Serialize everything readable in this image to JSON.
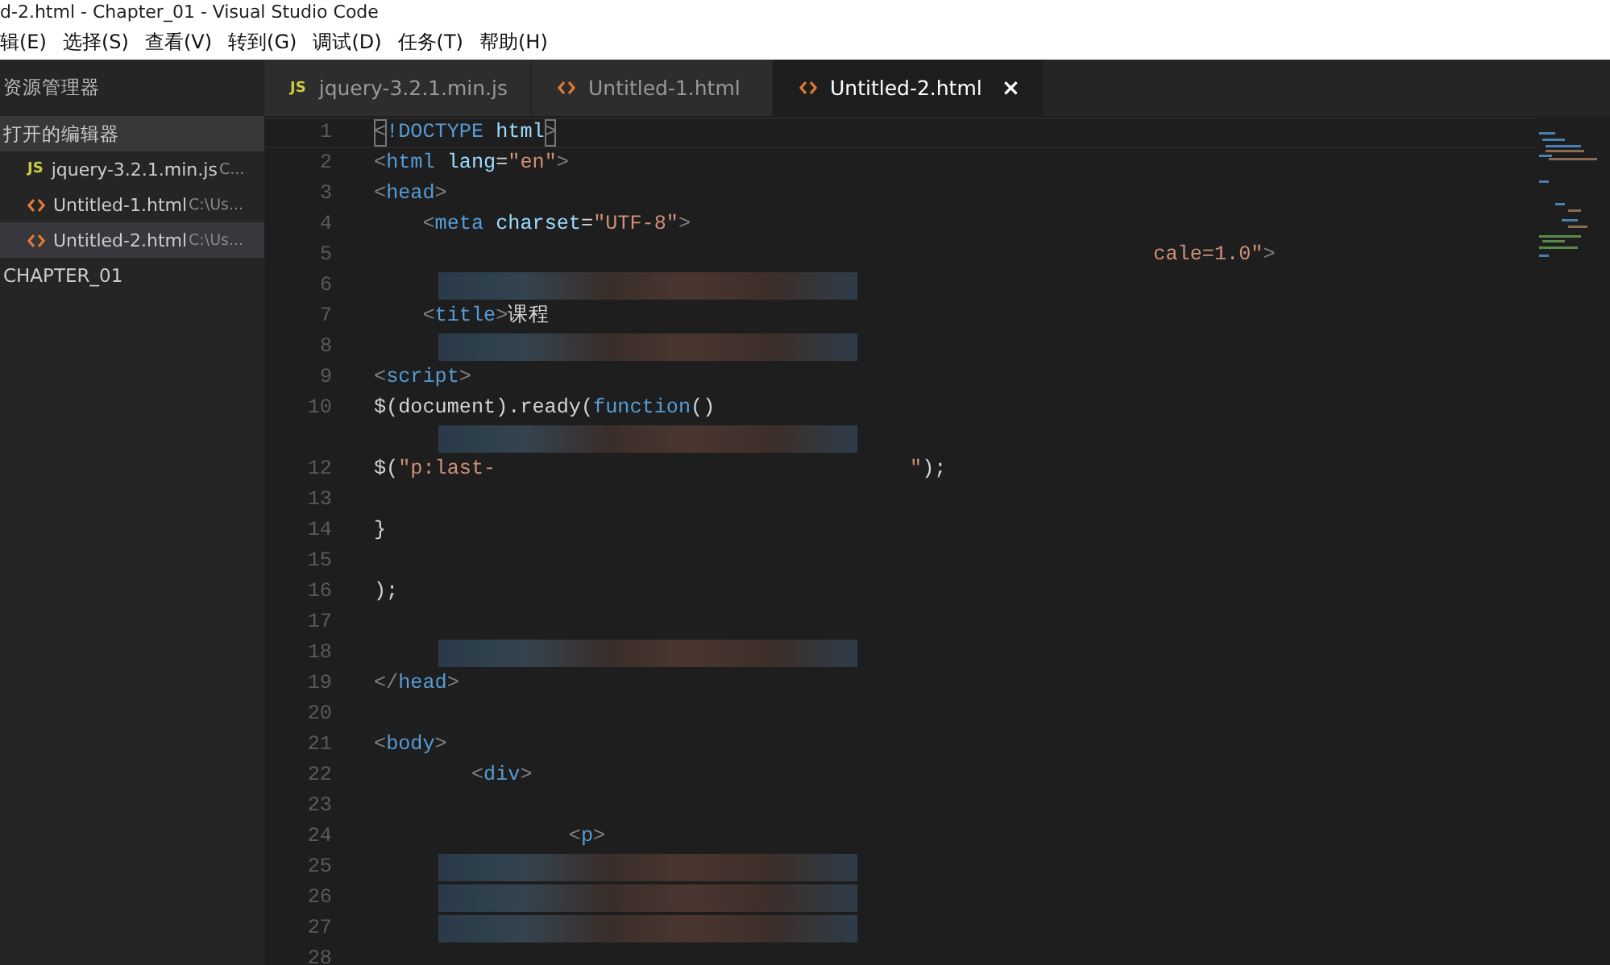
{
  "window": {
    "title": "d-2.html - Chapter_01 - Visual Studio Code"
  },
  "menu": [
    "辑(E)",
    "选择(S)",
    "查看(V)",
    "转到(G)",
    "调试(D)",
    "任务(T)",
    "帮助(H)"
  ],
  "sidebar": {
    "title": "资源管理器",
    "sections": [
      {
        "title": "打开的编辑器",
        "expanded": true,
        "items": [
          {
            "name": "jquery-3.2.1.min.js",
            "path": "C...",
            "kind": "js",
            "icon": "JS",
            "selected": false
          },
          {
            "name": "Untitled-1.html",
            "path": "C:\\Us...",
            "kind": "html",
            "selected": false
          },
          {
            "name": "Untitled-2.html",
            "path": "C:\\Us...",
            "kind": "html",
            "selected": true
          }
        ]
      },
      {
        "title": "CHAPTER_01",
        "expanded": false
      }
    ]
  },
  "tabs": [
    {
      "label": "jquery-3.2.1.min.js",
      "kind": "js",
      "icon": "JS",
      "selected": false
    },
    {
      "label": "Untitled-1.html",
      "kind": "html",
      "selected": false
    },
    {
      "label": "Untitled-2.html",
      "kind": "html",
      "selected": true,
      "close": "×"
    }
  ],
  "editor": {
    "lines": [
      {
        "number": "1",
        "tokens": [
          {
            "kind": "bracket",
            "text": "<"
          },
          {
            "kind": "tag",
            "text": "!DOCTYPE"
          },
          {
            "kind": "attr",
            "text": " html"
          },
          {
            "kind": "bracket",
            "text": ">"
          }
        ]
      },
      {
        "number": "2",
        "tokens": [
          {
            "kind": "punct",
            "text": "<"
          },
          {
            "kind": "tag",
            "text": "html"
          },
          {
            "kind": "attr",
            "text": " lang"
          },
          {
            "kind": "text",
            "text": "="
          },
          {
            "kind": "string",
            "text": "\"en\""
          },
          {
            "kind": "punct",
            "text": ">"
          }
        ]
      },
      {
        "number": "3",
        "tokens": [
          {
            "kind": "punct",
            "text": "<"
          },
          {
            "kind": "tag",
            "text": "head"
          },
          {
            "kind": "punct",
            "text": ">"
          }
        ]
      },
      {
        "number": "4",
        "tokens": [
          {
            "kind": "punct",
            "text": "    <"
          },
          {
            "kind": "tag",
            "text": "meta"
          },
          {
            "kind": "attr",
            "text": " charset"
          },
          {
            "kind": "text",
            "text": "="
          },
          {
            "kind": "string",
            "text": "\"UTF-8\""
          },
          {
            "kind": "punct",
            "text": ">"
          }
        ]
      },
      {
        "number": "5",
        "tokens": [
          {
            "kind": "string",
            "text": "                                                                cale=1.0\""
          },
          {
            "kind": "punct",
            "text": ">"
          }
        ]
      },
      {
        "number": "6",
        "obscured": true
      },
      {
        "number": "7",
        "tokens": [
          {
            "kind": "punct",
            "text": "    <"
          },
          {
            "kind": "tag",
            "text": "title"
          },
          {
            "kind": "punct",
            "text": ">"
          },
          {
            "kind": "text",
            "text": "课程"
          }
        ]
      },
      {
        "number": "8",
        "obscured": true
      },
      {
        "number": "9",
        "tokens": [
          {
            "kind": "punct",
            "text": "<"
          },
          {
            "kind": "tag",
            "text": "script"
          },
          {
            "kind": "punct",
            "text": ">"
          }
        ]
      },
      {
        "number": "10",
        "tokens": [
          {
            "kind": "text",
            "text": "$(document).ready("
          },
          {
            "kind": "tag",
            "text": "function"
          },
          {
            "kind": "text",
            "text": "()"
          }
        ]
      },
      {
        "obscured": true
      },
      {
        "number": "12",
        "tokens": [
          {
            "kind": "text",
            "text": "$("
          },
          {
            "kind": "string",
            "text": "\"p:last-"
          },
          {
            "kind": "string",
            "text": "                                  \""
          },
          {
            "kind": "text",
            "text": ");"
          }
        ]
      },
      {
        "number": "13"
      },
      {
        "number": "14",
        "tokens": [
          {
            "kind": "text",
            "text": "}"
          }
        ]
      },
      {
        "number": "15"
      },
      {
        "number": "16",
        "tokens": [
          {
            "kind": "text",
            "text": ");"
          }
        ]
      },
      {
        "number": "17"
      },
      {
        "number": "18",
        "obscured": true
      },
      {
        "number": "19",
        "tokens": [
          {
            "kind": "punct",
            "text": "</"
          },
          {
            "kind": "tag",
            "text": "head"
          },
          {
            "kind": "punct",
            "text": ">"
          }
        ]
      },
      {
        "number": "20"
      },
      {
        "number": "21",
        "tokens": [
          {
            "kind": "punct",
            "text": "<"
          },
          {
            "kind": "tag",
            "text": "body"
          },
          {
            "kind": "punct",
            "text": ">"
          }
        ]
      },
      {
        "number": "22",
        "tokens": [
          {
            "kind": "punct",
            "text": "        <"
          },
          {
            "kind": "tag",
            "text": "div"
          },
          {
            "kind": "punct",
            "text": ">"
          }
        ]
      },
      {
        "number": "23"
      },
      {
        "number": "24",
        "tokens": [
          {
            "kind": "punct",
            "text": "                <"
          },
          {
            "kind": "tag",
            "text": "p"
          },
          {
            "kind": "punct",
            "text": ">"
          }
        ]
      },
      {
        "number": "25",
        "obscured": true
      },
      {
        "number": "26",
        "obscured": true
      },
      {
        "number": "27",
        "obscured": true
      },
      {
        "number": "28"
      }
    ]
  }
}
